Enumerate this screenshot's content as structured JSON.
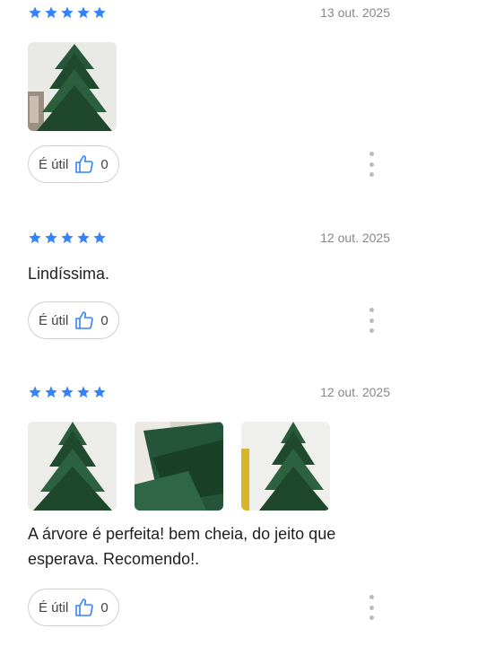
{
  "colors": {
    "star": "#3483fa",
    "thumb": "#3483fa",
    "tree_dark": "#1f4a2e",
    "tree_mid": "#2d6240"
  },
  "reviews": [
    {
      "rating": 5,
      "date": "13 out. 2025",
      "text": "",
      "photos": [
        "tree-photo-1"
      ],
      "useful_label": "É útil",
      "useful_count": "0"
    },
    {
      "rating": 5,
      "date": "12 out. 2025",
      "text": "Lindíssima.",
      "photos": [],
      "useful_label": "É útil",
      "useful_count": "0"
    },
    {
      "rating": 5,
      "date": "12 out. 2025",
      "text": "A árvore é perfeita! bem cheia, do jeito que esperava. Recomendo!.",
      "photos": [
        "tree-photo-1",
        "tree-photo-2",
        "tree-photo-3"
      ],
      "useful_label": "É útil",
      "useful_count": "0"
    }
  ]
}
